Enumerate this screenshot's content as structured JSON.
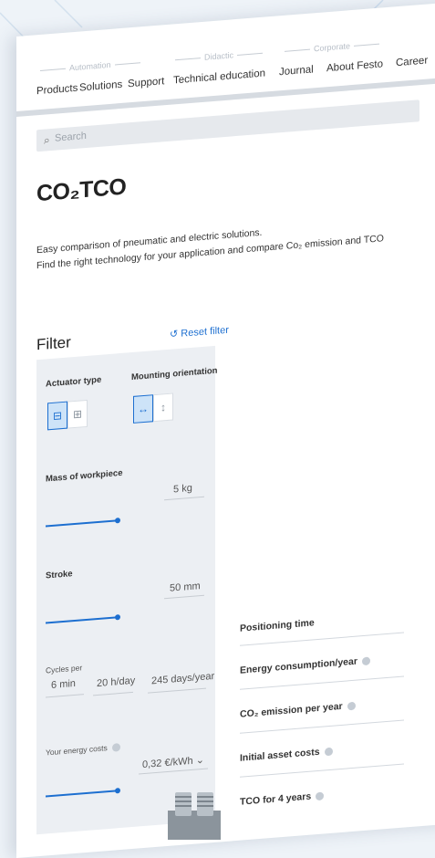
{
  "nav_groups": [
    "Automation",
    "Didactic",
    "Corporate"
  ],
  "nav_items": [
    "Products",
    "Solutions",
    "Support",
    "Technical education",
    "Journal",
    "About Festo",
    "Career"
  ],
  "search": {
    "placeholder": "Search"
  },
  "page_title": "CO₂TCO",
  "description": [
    "Easy comparison of pneumatic and electric solutions.",
    "Find the right technology for your application and compare Co₂ emission and TCO"
  ],
  "filter": {
    "title": "Filter",
    "reset_label": "Reset filter",
    "actuator_type_label": "Actuator type",
    "mounting_orientation_label": "Mounting orientation",
    "mass_label": "Mass of workpiece",
    "mass_value": "5",
    "mass_unit": "kg",
    "mass_slider_fraction": 0.5,
    "stroke_label": "Stroke",
    "stroke_value": "50",
    "stroke_unit": "mm",
    "stroke_slider_fraction": 0.5,
    "cycles_label": "Cycles per",
    "cycles_min": "6",
    "cycles_min_unit": "min",
    "hours": "20",
    "hours_unit": "h/day",
    "days": "245",
    "days_unit": "days/year",
    "energy_costs_label": "Your energy costs",
    "energy_value": "0,32",
    "energy_unit": "€/kWh",
    "energy_slider_fraction": 0.5
  },
  "results": [
    "Positioning time",
    "Energy consumption/year",
    "CO₂ emission per year",
    "Initial asset costs",
    "TCO for 4 years"
  ],
  "colors": {
    "accent": "#1d6fd0",
    "panel": "#eceff3",
    "background": "#eef3f8"
  }
}
